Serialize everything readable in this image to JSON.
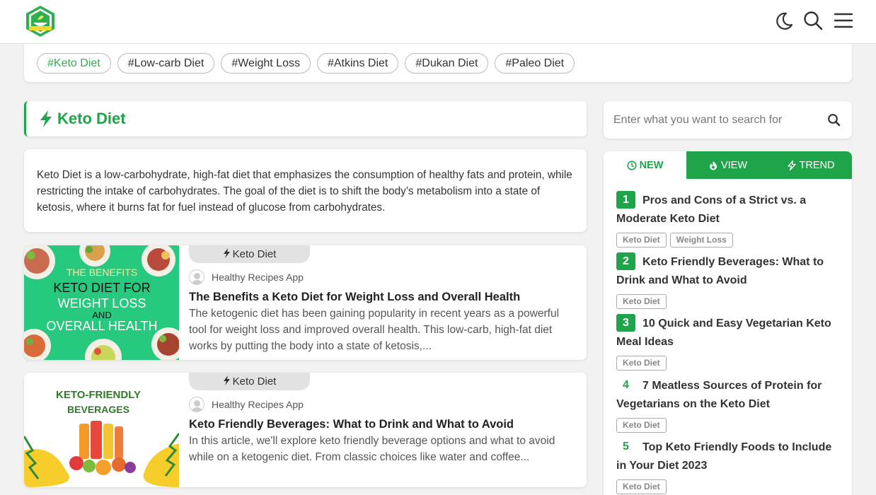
{
  "header": {
    "logo_alt": "logo",
    "icons": [
      "moon-icon",
      "search-icon",
      "menu-icon"
    ]
  },
  "tags": [
    "#Keto Diet",
    "#Low-carb Diet",
    "#Weight Loss",
    "#Atkins Diet",
    "#Dukan Diet",
    "#Paleo Diet"
  ],
  "category": {
    "title": "Keto Diet",
    "description": "Keto Diet is a low-carbohydrate, high-fat diet that emphasizes the consumption of healthy fats and protein, while restricting the intake of carbohydrates. The goal of the diet is to shift the body’s metabolism into a state of ketosis, where it burns fat for fuel instead of glucose from carbohydrates."
  },
  "articles": [
    {
      "category": "Keto Diet",
      "author": "Healthy Recipes App",
      "title": "The Benefits a Keto Diet for Weight Loss and Overall Health",
      "excerpt": "The ketogenic diet has been gaining popularity in recent years as a powerful tool for weight loss and improved overall health. This low-carb, high-fat diet works by putting the body into a state of ketosis,...",
      "thumb_lines": [
        "THE BENEFITS",
        "KETO DIET FOR",
        "WEIGHT LOSS",
        "AND",
        "OVERALL HEALTH"
      ]
    },
    {
      "category": "Keto Diet",
      "author": "Healthy Recipes App",
      "title": "Keto Friendly Beverages: What to Drink and What to Avoid",
      "excerpt": "In this article, we'll explore keto friendly beverage options and what to avoid while on a ketogenic diet. From classic choices like water and coffee...",
      "thumb_lines": [
        "KETO-FRIENDLY",
        "BEVERAGES"
      ]
    }
  ],
  "search": {
    "placeholder": "Enter what you want to search for"
  },
  "sidebar": {
    "tabs": [
      "NEW",
      "VIEW",
      "TREND"
    ],
    "items": [
      {
        "num": "1",
        "title": "Pros and Cons of a Strict vs. a Moderate Keto Diet",
        "tags": [
          "Keto Diet",
          "Weight Loss"
        ]
      },
      {
        "num": "2",
        "title": "Keto Friendly Beverages: What to Drink and What to Avoid",
        "tags": [
          "Keto Diet"
        ]
      },
      {
        "num": "3",
        "title": "10 Quick and Easy Vegetarian Keto Meal Ideas",
        "tags": [
          "Keto Diet"
        ]
      },
      {
        "num": "4",
        "title": "7 Meatless Sources of Protein for Vegetarians on the Keto Diet",
        "tags": [
          "Keto Diet"
        ]
      },
      {
        "num": "5",
        "title": "Top Keto Friendly Foods to Include in Your Diet 2023",
        "tags": [
          "Keto Diet"
        ]
      }
    ]
  },
  "colors": {
    "brand": "#1fa44a",
    "tag_active": "#2eaf4e"
  }
}
